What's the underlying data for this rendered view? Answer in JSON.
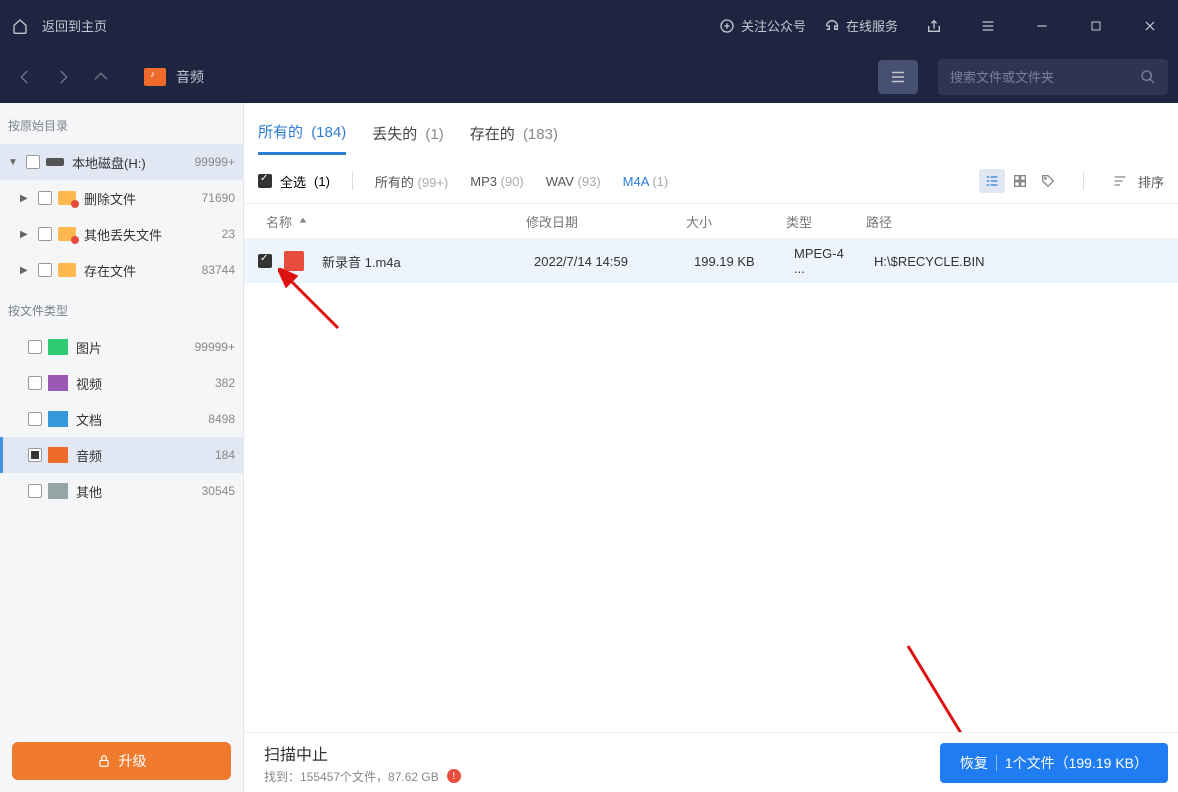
{
  "titlebar": {
    "back_home": "返回到主页",
    "follow": "关注公众号",
    "online": "在线服务"
  },
  "toolbar": {
    "breadcrumb": "音频",
    "search_placeholder": "搜索文件或文件夹"
  },
  "sidebar": {
    "section1": "按原始目录",
    "tree": [
      {
        "label": "本地磁盘(H:)",
        "count": "99999+"
      },
      {
        "label": "删除文件",
        "count": "71690"
      },
      {
        "label": "其他丢失文件",
        "count": "23"
      },
      {
        "label": "存在文件",
        "count": "83744"
      }
    ],
    "section2": "按文件类型",
    "types": [
      {
        "label": "图片",
        "count": "99999+"
      },
      {
        "label": "视频",
        "count": "382"
      },
      {
        "label": "文档",
        "count": "8498"
      },
      {
        "label": "音频",
        "count": "184"
      },
      {
        "label": "其他",
        "count": "30545"
      }
    ],
    "upgrade": "升级"
  },
  "tabs": {
    "all": {
      "label": "所有的",
      "count": "(184)"
    },
    "lost": {
      "label": "丢失的",
      "count": "(1)"
    },
    "exist": {
      "label": "存在的",
      "count": "(183)"
    }
  },
  "filters": {
    "select_all": "全选",
    "select_count": "(1)",
    "all": {
      "label": "所有的",
      "count": "(99+)"
    },
    "mp3": {
      "label": "MP3",
      "count": "(90)"
    },
    "wav": {
      "label": "WAV",
      "count": "(93)"
    },
    "m4a": {
      "label": "M4A",
      "count": "(1)"
    },
    "sort": "排序"
  },
  "columns": {
    "name": "名称",
    "date": "修改日期",
    "size": "大小",
    "type": "类型",
    "path": "路径"
  },
  "rows": [
    {
      "name": "新录音 1.m4a",
      "date": "2022/7/14 14:59",
      "size": "199.19 KB",
      "type": "MPEG-4 ...",
      "path": "H:\\$RECYCLE.BIN"
    }
  ],
  "footer": {
    "status_title": "扫描中止",
    "status_detail": "找到：155457个文件，87.62 GB",
    "recover_label": "恢复",
    "recover_detail": "1个文件（199.19 KB）"
  }
}
